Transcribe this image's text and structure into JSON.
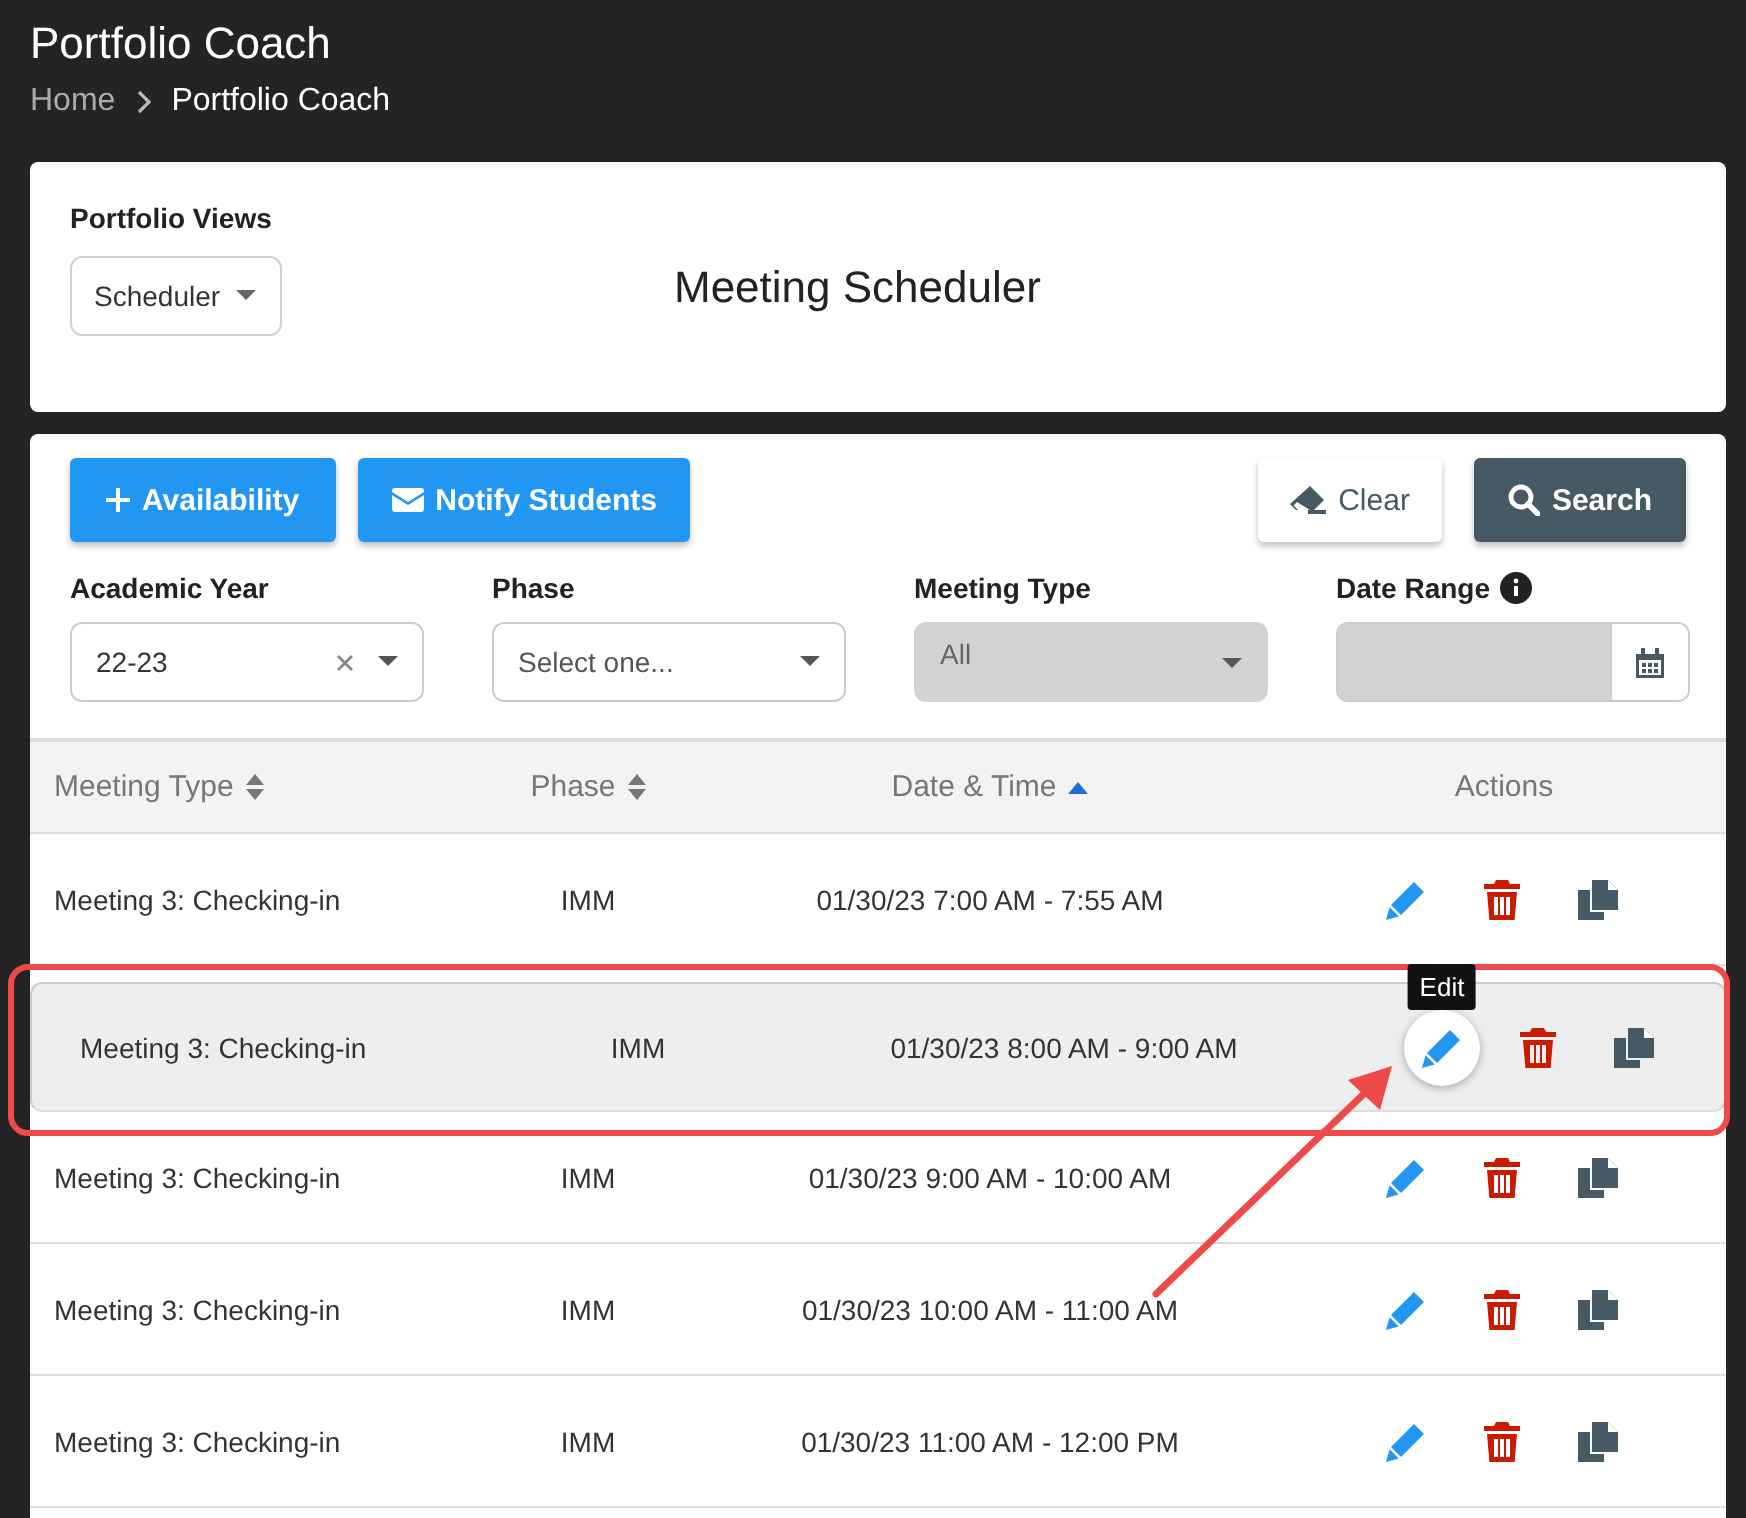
{
  "header": {
    "title": "Portfolio Coach",
    "breadcrumb": [
      {
        "label": "Home",
        "current": false
      },
      {
        "label": "Portfolio Coach",
        "current": true
      }
    ]
  },
  "views_card": {
    "label": "Portfolio Views",
    "view_select": "Scheduler",
    "heading": "Meeting Scheduler"
  },
  "toolbar": [
    {
      "label": "Availability",
      "kind": "add"
    },
    {
      "label": "Notify Students",
      "kind": "notify"
    },
    {
      "label": "Clear",
      "kind": "clear"
    },
    {
      "label": "Search",
      "kind": "search"
    }
  ],
  "filters": [
    {
      "label": "Academic Year",
      "kind": "select",
      "value": "22-23",
      "clearable": true,
      "disabled": false
    },
    {
      "label": "Phase",
      "kind": "select",
      "placeholder": "Select one...",
      "clearable": false,
      "disabled": false
    },
    {
      "label": "Meeting Type",
      "kind": "select",
      "value": "All",
      "clearable": false,
      "disabled": true
    },
    {
      "label": "Date Range",
      "kind": "date",
      "info": true,
      "disabled": true
    }
  ],
  "table": {
    "columns": [
      {
        "label": "Meeting Type",
        "sortable": true,
        "sorted": false
      },
      {
        "label": "Phase",
        "sortable": true,
        "sorted": false
      },
      {
        "label": "Date & Time",
        "sortable": true,
        "sorted": true
      },
      {
        "label": "Actions",
        "sortable": false
      }
    ],
    "rows": [
      {
        "meeting_type": "Meeting 3: Checking-in",
        "phase": "IMM",
        "date_time": "01/30/23 7:00 AM - 7:55 AM",
        "selected": false,
        "callout": false
      },
      {
        "meeting_type": "Meeting 3: Checking-in",
        "phase": "IMM",
        "date_time": "01/30/23 8:00 AM - 9:00 AM",
        "selected": true,
        "callout": true,
        "tooltip": "Edit"
      },
      {
        "meeting_type": "Meeting 3: Checking-in",
        "phase": "IMM",
        "date_time": "01/30/23 9:00 AM - 10:00 AM",
        "selected": false,
        "callout": false
      },
      {
        "meeting_type": "Meeting 3: Checking-in",
        "phase": "IMM",
        "date_time": "01/30/23 10:00 AM - 11:00 AM",
        "selected": false,
        "callout": false
      },
      {
        "meeting_type": "Meeting 3: Checking-in",
        "phase": "IMM",
        "date_time": "01/30/23 11:00 AM - 12:00 PM",
        "selected": false,
        "callout": false
      }
    ]
  }
}
